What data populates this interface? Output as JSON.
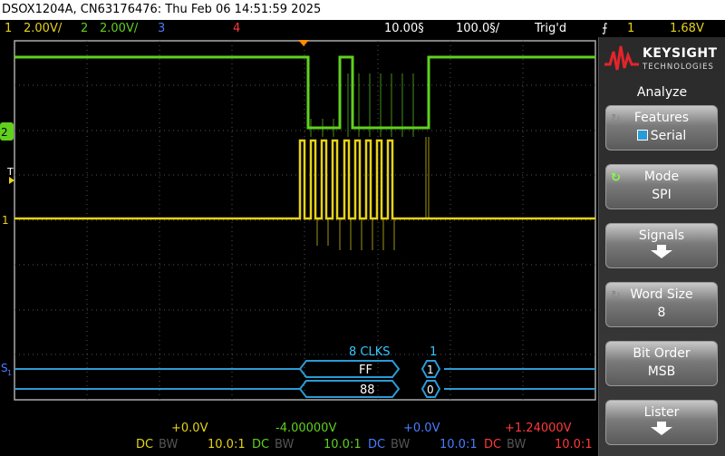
{
  "title_bar": {
    "text": "DSOX1204A, CN63176476: Thu Feb 06 14:51:59 2025"
  },
  "channels": {
    "ch1": {
      "num": "1",
      "scale": "2.00V/",
      "color": "#e6d21a"
    },
    "ch2": {
      "num": "2",
      "scale": "2.00V/",
      "color": "#5fd11e"
    },
    "ch3": {
      "num": "3",
      "color": "#4a7dff"
    },
    "ch4": {
      "num": "4",
      "color": "#ff3a3a"
    }
  },
  "timebase": {
    "delay": "10.00§",
    "scale": "100.0§/"
  },
  "trigger": {
    "state": "Trig'd",
    "channel": "1",
    "level": "1.68V"
  },
  "markers": {
    "ch2": "2",
    "trigger": "T",
    "ch1": "1",
    "serial": "S",
    "serial_sub": "1"
  },
  "serial_decode": {
    "header_clks": "8 CLKS",
    "header_count": "1",
    "mosi_value": "FF",
    "miso_value": "88",
    "mosi_short": "1",
    "miso_short": "0"
  },
  "logo": {
    "brand": "KEYSIGHT",
    "sub": "TECHNOLOGIES"
  },
  "menu": {
    "title": "Analyze",
    "keys": [
      {
        "label": "Features",
        "value": "Serial"
      },
      {
        "label": "Mode",
        "value": "SPI"
      },
      {
        "label": "Signals"
      },
      {
        "label": "Word Size",
        "value": "8"
      },
      {
        "label": "Bit Order",
        "value": "MSB"
      },
      {
        "label": "Lister"
      }
    ]
  },
  "bottom": {
    "offsets": {
      "ch1": "+0.0V",
      "ch2": "-4.00000V",
      "ch3": "+0.0V",
      "ch4": "+1.24000V"
    },
    "coupling": {
      "ch1": "DC",
      "ch2": "DC",
      "ch3": "DC",
      "ch4": "DC"
    },
    "bw": "BW",
    "probe": {
      "ch1": "10.0:1",
      "ch2": "10.0:1",
      "ch3": "10.0:1",
      "ch4": "10.0:1"
    }
  }
}
